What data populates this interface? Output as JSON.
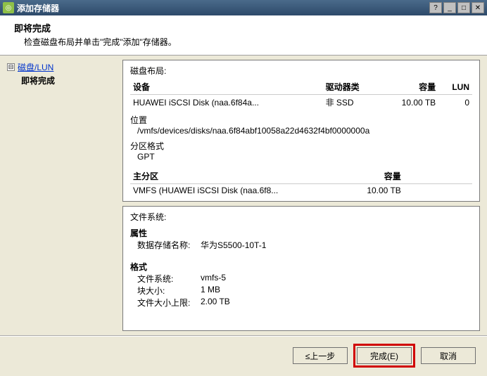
{
  "window": {
    "title": "添加存储器"
  },
  "header": {
    "title": "即将完成",
    "subtitle": "检查磁盘布局并单击\"完成\"添加\"存储器。"
  },
  "sidebar": {
    "item_link": "磁盘/LUN",
    "item_bold": "即将完成"
  },
  "disk_layout": {
    "title": "磁盘布局:",
    "cols": {
      "device": "设备",
      "driver": "驱动器类",
      "capacity": "容量",
      "lun": "LUN"
    },
    "row": {
      "device": "HUAWEI iSCSI Disk (naa.6f84a...",
      "driver": "非 SSD",
      "capacity": "10.00 TB",
      "lun": "0"
    },
    "location_label": "位置",
    "location_value": "/vmfs/devices/disks/naa.6f84abf10058a22d4632f4bf0000000a",
    "partfmt_label": "分区格式",
    "partfmt_value": "GPT",
    "primary_cols": {
      "primary": "主分区",
      "capacity": "容量"
    },
    "primary_row": {
      "name": "VMFS (HUAWEI iSCSI Disk (naa.6f8...",
      "capacity": "10.00 TB"
    }
  },
  "filesystem": {
    "title": "文件系统:",
    "attr_label": "属性",
    "ds_name_label": "数据存储名称:",
    "ds_name_value": "华为S5500-10T-1",
    "format_label": "格式",
    "fs_label": "文件系统:",
    "fs_value": "vmfs-5",
    "block_label": "块大小:",
    "block_value": "1 MB",
    "maxfile_label": "文件大小上限:",
    "maxfile_value": "2.00 TB"
  },
  "footer": {
    "back": "≤上一步",
    "finish": "完成(E)",
    "cancel": "取消"
  }
}
